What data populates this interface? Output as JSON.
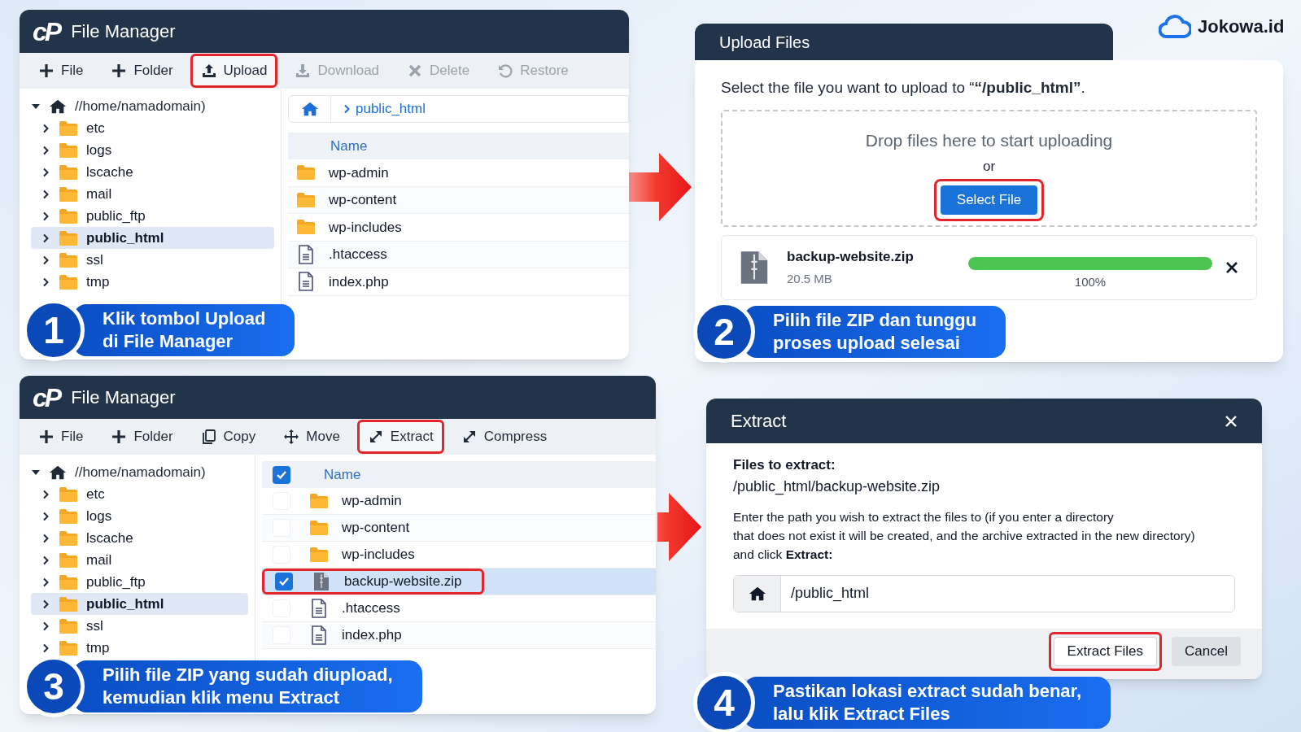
{
  "brand": {
    "name": "Jokowa.id"
  },
  "panels": [
    {
      "kind": "file_manager",
      "logo": "cP",
      "title": "File Manager",
      "toolbar": [
        {
          "kind": "add",
          "label": "File",
          "disabled": false,
          "highlighted": false
        },
        {
          "kind": "add",
          "label": "Folder",
          "disabled": false,
          "highlighted": false
        },
        {
          "kind": "upload",
          "label": "Upload",
          "disabled": false,
          "highlighted": true
        },
        {
          "kind": "download",
          "label": "Download",
          "disabled": true,
          "highlighted": false
        },
        {
          "kind": "delete",
          "label": "Delete",
          "disabled": true,
          "highlighted": false
        },
        {
          "kind": "restore",
          "label": "Restore",
          "disabled": true,
          "highlighted": false
        }
      ],
      "tree": {
        "label": "//home/namadomain)",
        "expanded": true,
        "children": [
          {
            "label": "etc",
            "selected": false
          },
          {
            "label": "logs",
            "selected": false
          },
          {
            "label": "lscache",
            "selected": false
          },
          {
            "label": "mail",
            "selected": false
          },
          {
            "label": "public_ftp",
            "selected": false
          },
          {
            "label": "public_html",
            "selected": true
          },
          {
            "label": "ssl",
            "selected": false
          },
          {
            "label": "tmp",
            "selected": false
          }
        ]
      },
      "breadcrumb": "public_html",
      "columns": [
        "Name"
      ],
      "files": [
        {
          "kind": "folder",
          "name": "wp-admin",
          "selected": false,
          "highlighted": false
        },
        {
          "kind": "folder",
          "name": "wp-content",
          "selected": false,
          "highlighted": false
        },
        {
          "kind": "folder",
          "name": "wp-includes",
          "selected": false,
          "highlighted": false
        },
        {
          "kind": "document",
          "name": ".htaccess",
          "selected": false,
          "highlighted": false
        },
        {
          "kind": "document",
          "name": "index.php",
          "selected": false,
          "highlighted": false
        }
      ],
      "step": {
        "number": "1",
        "caption": "Klik tombol Upload\ndi File Manager"
      }
    },
    {
      "kind": "upload_dialog",
      "title": "Upload Files",
      "message": "Select the file you want to upload to “**“/public_html”**.",
      "dropzone": "Drop files here to start uploading",
      "separator": "or",
      "button": {
        "label": "Select File",
        "highlighted": true
      },
      "uploads": [
        {
          "name": "backup-website.zip",
          "size": "20.5 MB",
          "level": 1,
          "percent": "100%"
        }
      ],
      "step": {
        "number": "2",
        "caption": "Pilih file ZIP dan tunggu\nproses upload selesai"
      }
    },
    {
      "kind": "file_manager",
      "logo": "cP",
      "title": "File Manager",
      "toolbar": [
        {
          "kind": "add",
          "label": "File",
          "disabled": false,
          "highlighted": false
        },
        {
          "kind": "add",
          "label": "Folder",
          "disabled": false,
          "highlighted": false
        },
        {
          "kind": "copy",
          "label": "Copy",
          "disabled": false,
          "highlighted": false
        },
        {
          "kind": "move",
          "label": "Move",
          "disabled": false,
          "highlighted": false
        },
        {
          "kind": "extract",
          "label": "Extract",
          "disabled": false,
          "highlighted": true
        },
        {
          "kind": "compress",
          "label": "Compress",
          "disabled": false,
          "highlighted": false
        }
      ],
      "tree": {
        "label": "//home/namadomain)",
        "expanded": true,
        "children": [
          {
            "label": "etc",
            "selected": false
          },
          {
            "label": "logs",
            "selected": false
          },
          {
            "label": "lscache",
            "selected": false
          },
          {
            "label": "mail",
            "selected": false
          },
          {
            "label": "public_ftp",
            "selected": false
          },
          {
            "label": "public_html",
            "selected": true
          },
          {
            "label": "ssl",
            "selected": false
          },
          {
            "label": "tmp",
            "selected": false
          }
        ]
      },
      "select_all_checked": true,
      "columns": [
        "Name"
      ],
      "files": [
        {
          "kind": "folder",
          "name": "wp-admin",
          "selected": false,
          "checked": false,
          "highlighted": false
        },
        {
          "kind": "folder",
          "name": "wp-content",
          "selected": false,
          "checked": false,
          "highlighted": false
        },
        {
          "kind": "folder",
          "name": "wp-includes",
          "selected": false,
          "checked": false,
          "highlighted": false
        },
        {
          "kind": "archive",
          "name": "backup-website.zip",
          "selected": true,
          "checked": true,
          "highlighted": true
        },
        {
          "kind": "document",
          "name": ".htaccess",
          "selected": false,
          "checked": false,
          "highlighted": false
        },
        {
          "kind": "document",
          "name": "index.php",
          "selected": false,
          "checked": false,
          "highlighted": false
        }
      ],
      "step": {
        "number": "3",
        "caption": "Pilih file ZIP yang sudah diupload,\nkemudian klik menu Extract"
      }
    },
    {
      "kind": "extract_dialog",
      "title": "Extract",
      "files_label": "Files to extract:",
      "files_path": "/public_html/backup-website.zip",
      "instructions": "Enter the path you wish to extract the files to (if you enter a directory\nthat does not exist it will be created, and the archive extracted in the new directory)\nand click **Extract:**",
      "path": "/public_html",
      "buttons": [
        {
          "label": "Extract Files",
          "highlighted": true
        },
        {
          "label": "Cancel",
          "highlighted": false
        }
      ],
      "step": {
        "number": "4",
        "caption": "Pastikan lokasi extract sudah benar,\nlalu klik Extract Files"
      }
    }
  ]
}
